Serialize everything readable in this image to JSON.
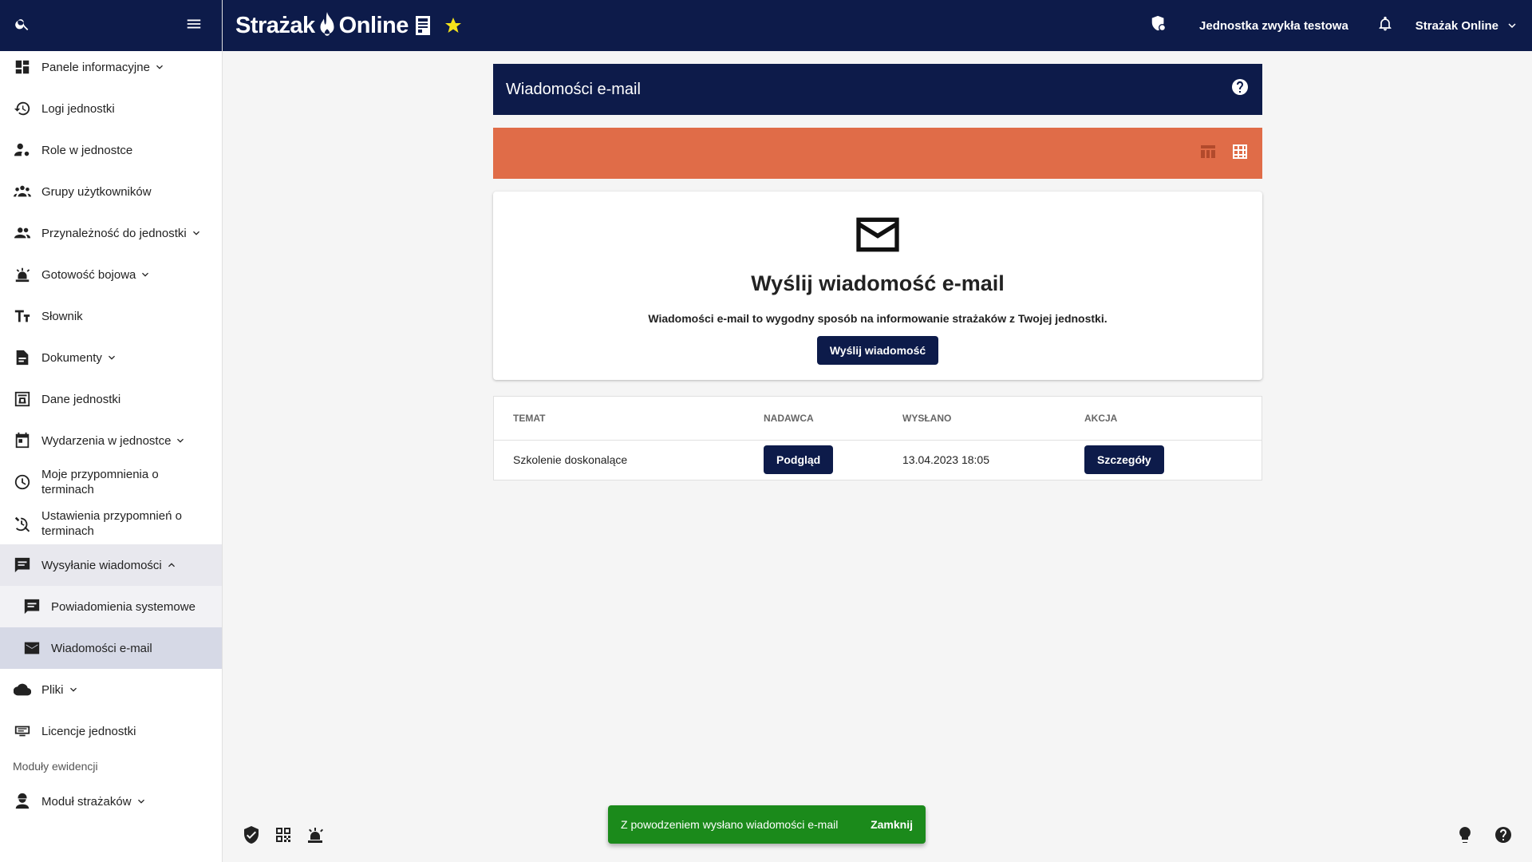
{
  "app": {
    "brand_left": "Strażak",
    "brand_right": "Online"
  },
  "topbar": {
    "unit_name": "Jednostka zwykła testowa",
    "user_menu": "Strażak Online"
  },
  "sidebar": {
    "items": [
      {
        "label": "Panele informacyjne",
        "icon": "dashboard-icon"
      },
      {
        "label": "Logi jednostki",
        "icon": "history-icon"
      },
      {
        "label": "Role w jednostce",
        "icon": "person-gear-icon"
      },
      {
        "label": "Grupy użytkowników",
        "icon": "groups-icon"
      },
      {
        "label": "Przynależność do jednostki",
        "icon": "people-icon"
      },
      {
        "label": "Gotowość bojowa",
        "icon": "alarm-light-icon"
      },
      {
        "label": "Słownik",
        "icon": "text-fields-icon"
      },
      {
        "label": "Dokumenty",
        "icon": "document-icon"
      },
      {
        "label": "Dane jednostki",
        "icon": "fire-station-icon"
      },
      {
        "label": "Wydarzenia w jednostce",
        "icon": "calendar-icon"
      },
      {
        "label": "Moje przypomnienia o terminach",
        "icon": "clock-icon"
      },
      {
        "label": "Ustawienia przypomnień o terminach",
        "icon": "clock-settings-icon"
      },
      {
        "label": "Wysyłanie wiadomości",
        "icon": "message-icon"
      },
      {
        "label": "Powiadomienia systemowe",
        "icon": "message-icon"
      },
      {
        "label": "Wiadomości e-mail",
        "icon": "mail-icon"
      },
      {
        "label": "Pliki",
        "icon": "cloud-icon"
      },
      {
        "label": "Licencje jednostki",
        "icon": "license-icon"
      }
    ],
    "section_label": "Moduły ewidencji",
    "module_item": "Moduł strażaków"
  },
  "page": {
    "title": "Wiadomości e-mail",
    "cta_heading": "Wyślij wiadomość e-mail",
    "cta_text": "Wiadomości e-mail to wygodny sposób na informowanie strażaków z Twojej jednostki.",
    "cta_button": "Wyślij wiadomość"
  },
  "table": {
    "columns": [
      "TEMAT",
      "NADAWCA",
      "WYSŁANO",
      "AKCJA"
    ],
    "rows": [
      {
        "subject": "Szkolenie doskonalące",
        "sender_button": "Podgląd",
        "sent": "13.04.2023 18:05",
        "action_button": "Szczegóły"
      }
    ]
  },
  "snackbar": {
    "message": "Z powodzeniem wysłano wiadomości e-mail",
    "close": "Zamknij"
  },
  "colors": {
    "navy": "#0d1b4a",
    "orange": "#e06c48",
    "success": "#1b8a1b",
    "star": "#f4e21b"
  }
}
